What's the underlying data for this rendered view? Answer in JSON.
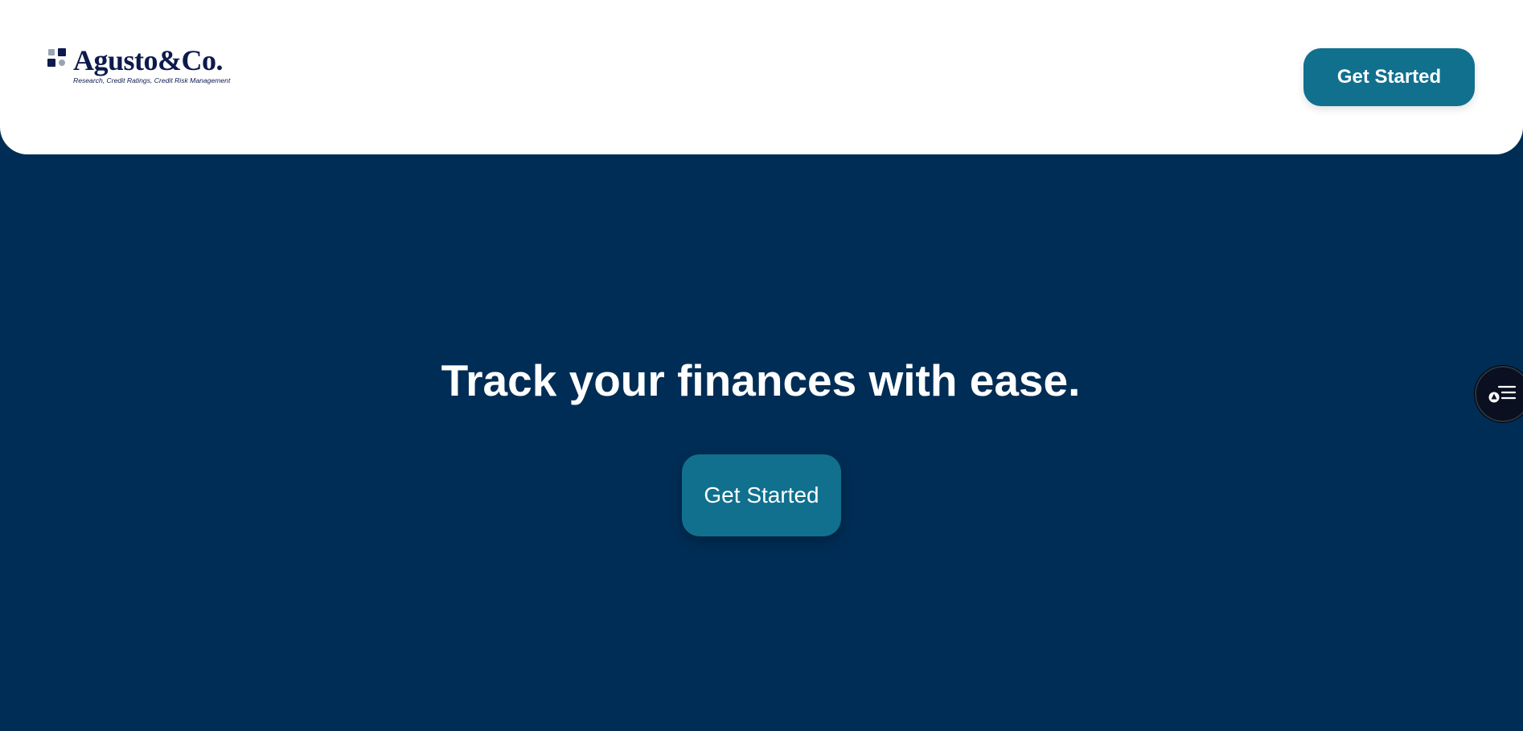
{
  "header": {
    "logo": {
      "name": "Agusto&Co.",
      "tagline": "Research, Credit Ratings, Credit Risk Management"
    },
    "cta_label": "Get Started"
  },
  "hero": {
    "title": "Track your finances with ease.",
    "cta_label": "Get Started"
  },
  "widget": {
    "icon": "accessibility-menu-icon"
  },
  "colors": {
    "background": "#002d55",
    "header_bg": "#ffffff",
    "button_bg": "#10708e",
    "logo_navy": "#0d1a4d",
    "logo_gray": "#9aa3b5"
  }
}
